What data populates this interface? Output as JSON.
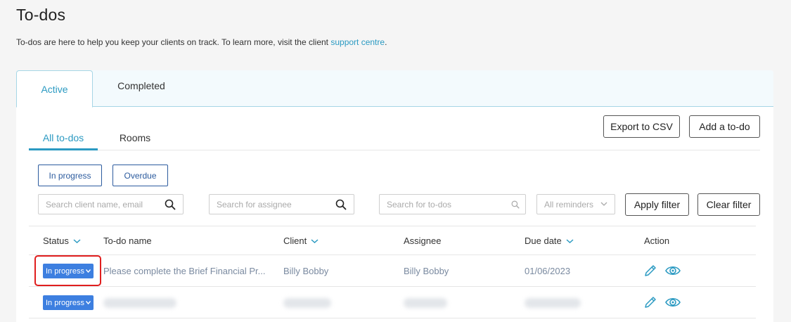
{
  "page": {
    "title": "To-dos",
    "intro_text": "To-dos are here to help you keep your clients on track. To learn more, visit the client ",
    "intro_link": "support centre",
    "intro_end": "."
  },
  "main_tabs": [
    {
      "label": "Active"
    },
    {
      "label": "Completed"
    }
  ],
  "sub_tabs": [
    {
      "label": "All to-dos"
    },
    {
      "label": "Rooms"
    }
  ],
  "toolbar": {
    "export_label": "Export to CSV",
    "add_label": "Add a to-do"
  },
  "chips": [
    {
      "label": "In progress"
    },
    {
      "label": "Overdue"
    }
  ],
  "filters": {
    "client_placeholder": "Search client name, email",
    "assignee_placeholder": "Search for assignee",
    "todo_placeholder": "Search for to-dos",
    "reminders_value": "All reminders",
    "apply_label": "Apply filter",
    "clear_label": "Clear filter"
  },
  "table": {
    "columns": [
      "Status",
      "To-do name",
      "Client",
      "Assignee",
      "Due date",
      "Action"
    ],
    "rows": [
      {
        "status": "In progress",
        "name": "Please complete the Brief Financial Pr...",
        "client": "Billy Bobby",
        "assignee": "Billy Bobby",
        "due": "01/06/2023"
      },
      {
        "status": "In progress"
      }
    ]
  },
  "colors": {
    "accent": "#2b9ac2",
    "status_button": "#3d7fe0",
    "highlight": "#e01e1e"
  },
  "icons": [
    "search-icon",
    "chevron-down-icon",
    "pencil-icon",
    "eye-icon"
  ]
}
